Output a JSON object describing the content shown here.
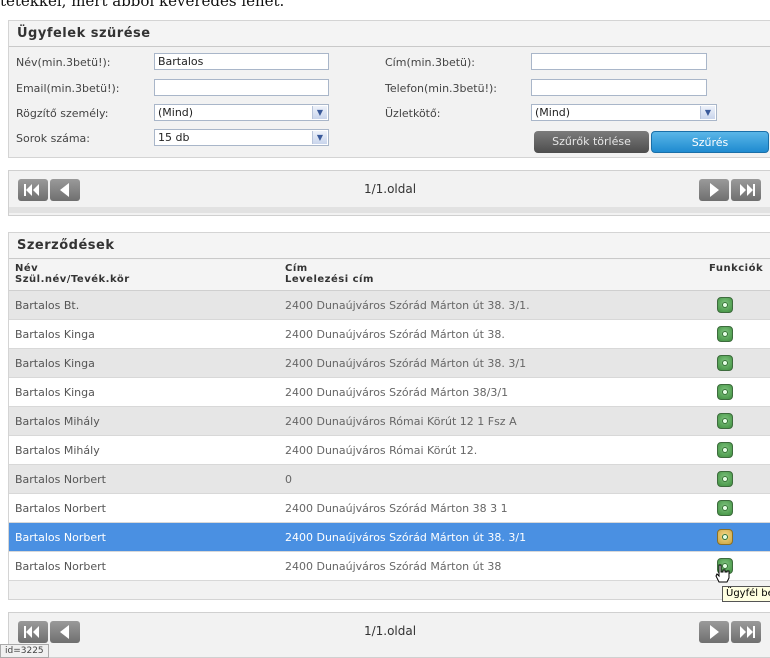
{
  "page_header_fragment": "tetekkel, mert abból keveredés lehet.",
  "filter": {
    "title": "Ügyfelek szürése",
    "name_label": "Név(min.3betü!):",
    "name_value": "Bartalos",
    "address_label": "Cím(min.3betü):",
    "address_value": "",
    "email_label": "Email(min.3betü!):",
    "email_value": "",
    "phone_label": "Telefon(min.3betü!):",
    "phone_value": "",
    "recorder_label": "Rögzítő személy:",
    "recorder_value": "(Mind)",
    "contractor_label": "Üzletkötő:",
    "contractor_value": "(Mind)",
    "rows_label": "Sorok száma:",
    "rows_value": "15 db",
    "clear_button": "Szűrők törlése",
    "filter_button": "Szűrés"
  },
  "pager_top": {
    "page_label": "1/1.oldal"
  },
  "pager_bottom": {
    "page_label": "1/1.oldal"
  },
  "contracts": {
    "title": "Szerződések",
    "col_name": "Név",
    "col_name_sub": "Szül.név/Tevék.kör",
    "col_address": "Cím",
    "col_address_sub": "Levelezési cím",
    "col_functions": "Funkciók",
    "rows": [
      {
        "name": "Bartalos Bt.",
        "address": "2400 Dunaújváros Szórád Márton út 38. 3/1."
      },
      {
        "name": "Bartalos Kinga",
        "address": "2400 Dunaújváros Szórád Márton út 38."
      },
      {
        "name": "Bartalos Kinga",
        "address": "2400 Dunaújváros Szórád Márton út 38. 3/1"
      },
      {
        "name": "Bartalos Kinga",
        "address": "2400 Dunaújváros Szórád Márton 38/3/1"
      },
      {
        "name": "Bartalos Mihály",
        "address": "2400 Dunaújváros Római Körút 12 1 Fsz A"
      },
      {
        "name": "Bartalos Mihály",
        "address": "2400 Dunaújváros Római Körút 12."
      },
      {
        "name": "Bartalos Norbert",
        "address": "0"
      },
      {
        "name": "Bartalos Norbert",
        "address": "2400 Dunaújváros Szórád Márton 38 3 1"
      },
      {
        "name": "Bartalos Norbert",
        "address": "2400 Dunaújváros Szórád Márton út 38. 3/1"
      },
      {
        "name": "Bartalos Norbert",
        "address": "2400 Dunaújváros Szórád Márton út 38"
      }
    ],
    "selected_row_index": 8,
    "tooltip": "Ügyfél be"
  },
  "status": {
    "text": "id=3225"
  },
  "colors": {
    "selected_row": "#4a90e2",
    "filter_button": "#1f8bd0",
    "clear_button": "#5a5a5a",
    "function_icon": "#3f8f3f"
  },
  "icons": {
    "pager_first": "first-page-icon",
    "pager_prev": "prev-page-icon",
    "pager_next": "next-page-icon",
    "pager_last": "last-page-icon",
    "row_function": "function-icon"
  }
}
